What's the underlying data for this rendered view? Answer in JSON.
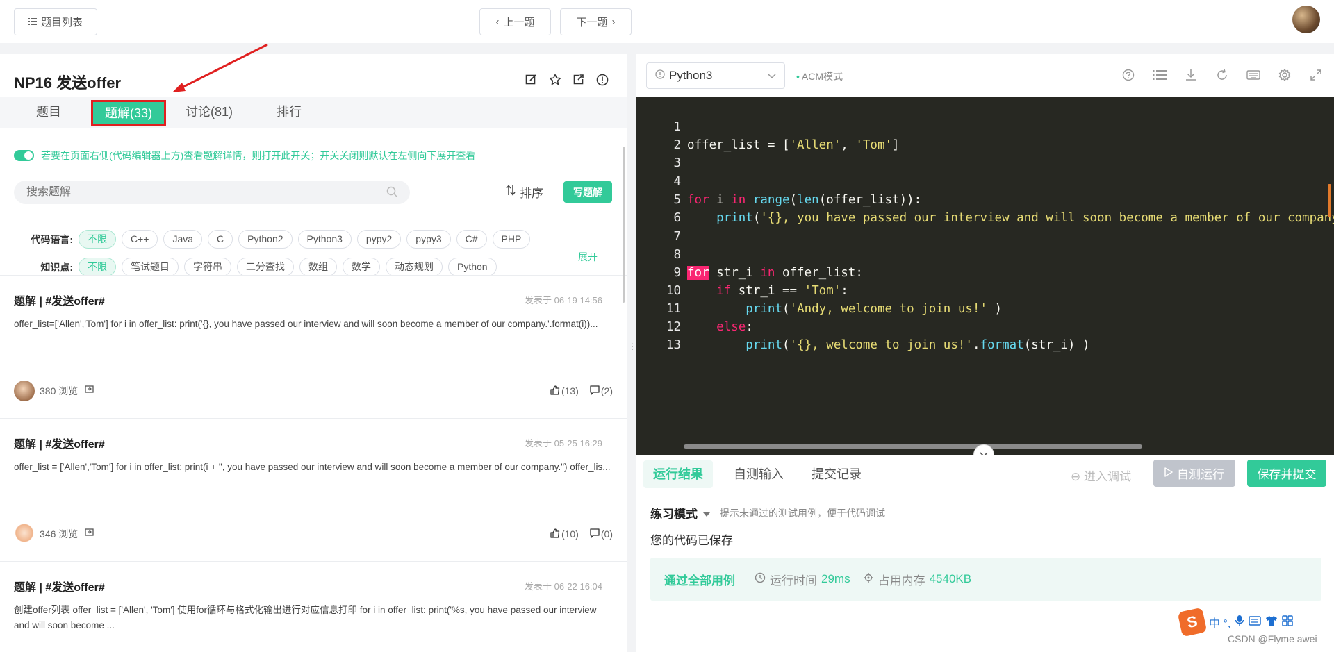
{
  "topbar": {
    "list_label": "题目列表",
    "prev_label": "上一题",
    "next_label": "下一题"
  },
  "problem": {
    "title": "NP16  发送offer",
    "icons": [
      "edit-icon",
      "star-icon",
      "share-link-icon",
      "info-icon"
    ]
  },
  "tabs": [
    {
      "label": "题目"
    },
    {
      "label": "题解(33)"
    },
    {
      "label": "讨论(81)"
    },
    {
      "label": "排行"
    }
  ],
  "toggle_text": "若要在页面右侧(代码编辑器上方)查看题解详情，则打开此开关；开关关闭则默认在左侧向下展开查看",
  "search": {
    "placeholder": "搜索题解"
  },
  "sort_label": "排序",
  "write_label": "写题解",
  "filters": {
    "lang_label": "代码语言:",
    "langs": [
      "不限",
      "C++",
      "Java",
      "C",
      "Python2",
      "Python3",
      "pypy2",
      "pypy3",
      "C#",
      "PHP"
    ],
    "topic_label": "知识点:",
    "topics": [
      "不限",
      "笔试题目",
      "字符串",
      "二分查找",
      "数组",
      "数学",
      "动态规划",
      "Python"
    ],
    "expand_label": "展开"
  },
  "posts": [
    {
      "title": "题解 | #发送offer#",
      "date": "发表于 06-19 14:56",
      "body": "offer_list=['Allen','Tom'] for i in offer_list: print('{}, you have passed our interview and will soon become a member of our company.'.format(i))...",
      "views": "380 浏览",
      "likes": "(13)",
      "comments": "(2)"
    },
    {
      "title": "题解 | #发送offer#",
      "date": "发表于 05-25 16:29",
      "body": "offer_list = ['Allen','Tom'] for i in offer_list: print(i + \", you have passed our interview and will soon become a member of our company.\") offer_lis...",
      "views": "346 浏览",
      "likes": "(10)",
      "comments": "(0)"
    },
    {
      "title": "题解 | #发送offer#",
      "date": "发表于 06-22 16:04",
      "body": "创建offer列表 offer_list = ['Allen', 'Tom'] 使用for循环与格式化输出进行对应信息打印 for i in offer_list: print('%s, you have passed our interview and will soon become ..."
    }
  ],
  "editor": {
    "language": "Python3",
    "mode": "ACM模式",
    "toolbar_icons": [
      "help-icon",
      "list-icon",
      "download-icon",
      "reload-icon",
      "keyboard-icon",
      "settings-icon",
      "fullscreen-icon"
    ],
    "line_numbers": [
      "1",
      "2",
      "3",
      "4",
      "5",
      "6",
      "7",
      "8",
      "9",
      "10",
      "11",
      "12",
      "13"
    ],
    "code_lines": [
      "offer_list = ['Allen', 'Tom']",
      "",
      "",
      "for i in range(len(offer_list)):",
      "    print('{}, you have passed our interview and will soon become a member of our company.'.format(offer_list[i]))",
      "",
      "",
      "for str_i in offer_list:",
      "    if str_i == 'Tom':",
      "        print('Andy, welcome to join us!' )",
      "    else:",
      "        print('{}, welcome to join us!'.format(str_i) )",
      ""
    ]
  },
  "bottom": {
    "tabs": [
      "运行结果",
      "自测输入",
      "提交记录"
    ],
    "debug_label": "进入调试",
    "selfrun_label": "自测运行",
    "submit_label": "保存并提交",
    "mode_label": "练习模式",
    "mode_hint": "提示未通过的测试用例，便于代码调试",
    "saved_text": "您的代码已保存",
    "pass_text": "通过全部用例",
    "time_label": "运行时间",
    "time_value": "29ms",
    "mem_label": "占用内存",
    "mem_value": "4540KB"
  },
  "ime_text": "中 °,",
  "watermark": "CSDN @Flyme awei",
  "colors": {
    "accent": "#32ca99",
    "highlight": "#e02020",
    "editor_bg": "#272822"
  }
}
